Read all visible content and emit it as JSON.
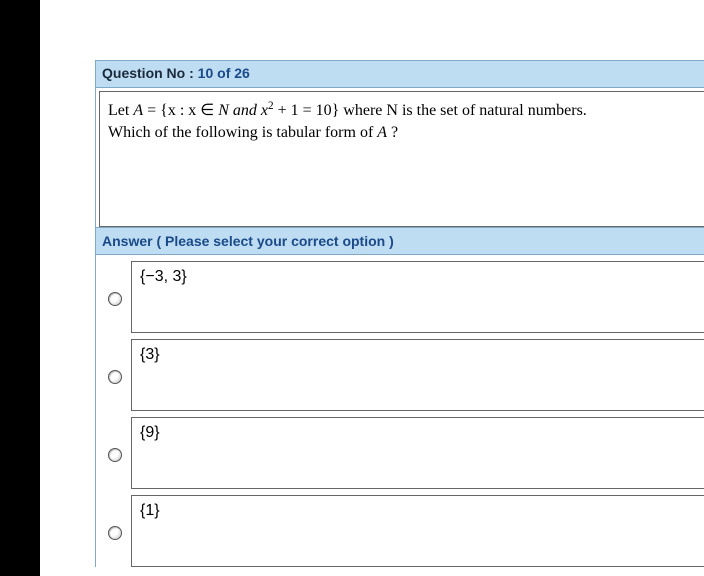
{
  "question": {
    "label_prefix": "Question No : ",
    "current": "10",
    "of_word": " of ",
    "total": "26",
    "text_line1_pre": "Let ",
    "text_line1_A": "A",
    "text_line1_mid": " = {x : x ∈ ",
    "text_line1_N": "N",
    "text_line1_and": " and x",
    "text_line1_exp": "2",
    "text_line1_rest": " + 1 = 10}  where N is the set of natural numbers.",
    "text_line2": "Which of the following is tabular form of ",
    "text_line2_A": "A",
    "text_line2_end": " ?"
  },
  "answer_header": "Answer ( Please select your correct option )",
  "options": [
    {
      "text": "{−3, 3}"
    },
    {
      "text": "{3}"
    },
    {
      "text": "{9}"
    },
    {
      "text": "{1}"
    }
  ]
}
